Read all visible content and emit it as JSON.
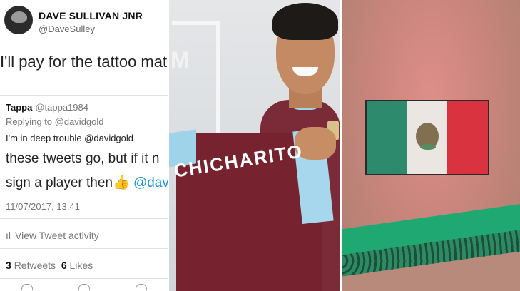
{
  "tweet": {
    "author_name": "DAVE SULLIVAN JNR",
    "author_handle": "@DaveSulley",
    "text": "I'll pay for the tattoo mate."
  },
  "reply": {
    "name": "Tappa",
    "handle": "@tappa1984",
    "replying_to": "Replying to @davidgold",
    "line1": "I'm in deep trouble @davidgold",
    "line2": "these tweets go, but if it n",
    "line3_text": "sign a player then",
    "line3_mention": "@dav",
    "date": "11/07/2017, 13:41",
    "activity": "View Tweet activity",
    "retweets_count": "3",
    "retweets_label": "Retweets",
    "likes_count": "6",
    "likes_label": "Likes"
  },
  "photo_player": {
    "jersey_text": "CHICHARITO",
    "wall_letter": "M"
  },
  "colors": {
    "claret": "#7b2a37",
    "sky_blue": "#9fd3ea",
    "flag_green": "#2e8a6c",
    "flag_white": "#ece6e2",
    "flag_red": "#d9333f",
    "link_blue": "#1b95e0"
  }
}
